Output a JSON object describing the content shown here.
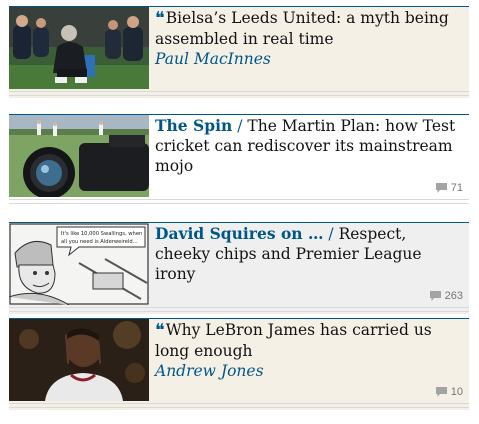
{
  "articles": [
    {
      "kicker": "",
      "title": "Bielsa’s Leeds United: a myth being assembled in real time",
      "byline": "Paul MacInnes",
      "comments": "",
      "image": "Football manager crouching beside the pitch with substitutes seated on the bench behind"
    },
    {
      "kicker": "The Spin",
      "separator": "/",
      "title": "The Martin Plan: how Test cricket can rediscover its mainstream mojo",
      "byline": "",
      "comments": "71",
      "image": "Close-up of a camera lens over a cricket ground with players in white"
    },
    {
      "kicker": "David Squires on …",
      "separator": "/",
      "title": "Respect, cheeky chips and Premier League irony",
      "byline": "",
      "comments": "263",
      "image": "Cartoon strip of a grey-haired man in a woolly hat",
      "cartoon_text": "It's like 10,000 Swallings, when all you need is Alderweireld..."
    },
    {
      "kicker": "",
      "title": "Why LeBron James has carried us long enough",
      "byline": "Andrew Jones",
      "comments": "10",
      "image": "Basketball player in a white jersey looking up in a crowded arena"
    }
  ],
  "icons": {
    "quote": "quote-icon",
    "comment": "comment-icon"
  },
  "colors": {
    "accent": "#005689",
    "opinion_bg": "#f5f0e6",
    "cartoon_bg": "#efefef"
  }
}
